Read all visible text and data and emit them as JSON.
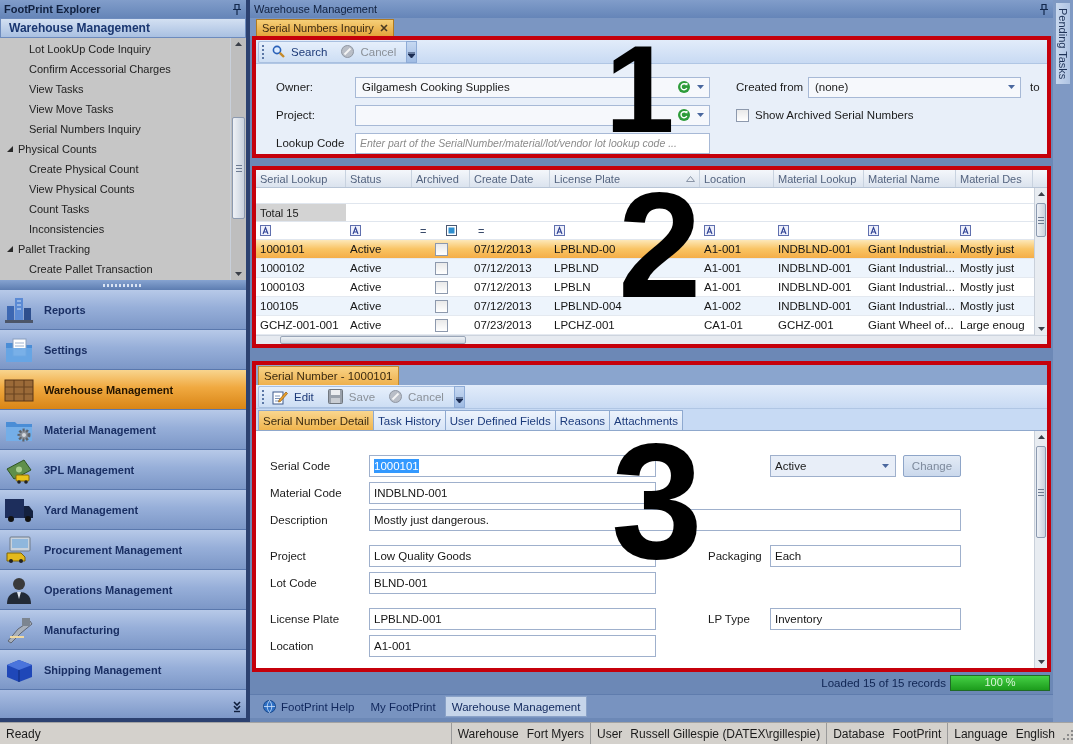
{
  "explorer": {
    "title": "FootPrint Explorer",
    "group": "Warehouse Management",
    "tree": [
      {
        "children": [
          {
            "label": "Lot LookUp Code Inquiry"
          },
          {
            "label": "Confirm Accessorial Charges"
          },
          {
            "label": "View Tasks"
          },
          {
            "label": "View Move Tasks"
          },
          {
            "label": "Serial Numbers Inquiry"
          }
        ]
      },
      {
        "label": "Physical Counts",
        "expanded": true,
        "children": [
          {
            "label": "Create Physical Count"
          },
          {
            "label": "View Physical Counts"
          },
          {
            "label": "Count Tasks"
          },
          {
            "label": "Inconsistencies"
          }
        ]
      },
      {
        "label": "Pallet Tracking",
        "expanded": true,
        "children": [
          {
            "label": "Create Pallet Transaction"
          }
        ]
      }
    ]
  },
  "nav": [
    {
      "label": "Reports",
      "kind": "building",
      "selected": false
    },
    {
      "label": "Settings",
      "kind": "folder",
      "selected": false
    },
    {
      "label": "Warehouse Management",
      "kind": "crate",
      "selected": true
    },
    {
      "label": "Material Management",
      "kind": "gear",
      "selected": false
    },
    {
      "label": "3PL Management",
      "kind": "cash",
      "selected": false
    },
    {
      "label": "Yard Management",
      "kind": "truck",
      "selected": false
    },
    {
      "label": "Procurement Management",
      "kind": "computer",
      "selected": false
    },
    {
      "label": "Operations Management",
      "kind": "person",
      "selected": false
    },
    {
      "label": "Manufacturing",
      "kind": "machine",
      "selected": false
    },
    {
      "label": "Shipping Management",
      "kind": "cube",
      "selected": false
    }
  ],
  "workspace": {
    "title": "Warehouse Management",
    "document_tab": {
      "label": "Serial Numbers Inquiry",
      "selected": true
    }
  },
  "search_panel": {
    "annotation": "1",
    "toolbar": [
      {
        "label": "Search",
        "kind": "search",
        "disabled": false
      },
      {
        "label": "Cancel",
        "kind": "cancel",
        "disabled": true
      }
    ],
    "fields": [
      {
        "kind": "combo",
        "label": "Owner:",
        "value": "Gilgamesh Cooking Supplies"
      },
      {
        "kind": "combo",
        "label": "Project:"
      },
      {
        "kind": "text",
        "label": "Lookup Code",
        "placeholder": "Enter part of the SerialNumber/material/lot/vendor lot lookup code ..."
      }
    ],
    "created_from": {
      "label": "Created from",
      "value": "(none)",
      "after": "to"
    },
    "show_archived": {
      "label": "Show Archived Serial Numbers",
      "checked": false
    }
  },
  "grid": {
    "annotation": "2",
    "columns": [
      {
        "label": "Serial Lookup",
        "sorted": false
      },
      {
        "label": "Status",
        "sorted": false
      },
      {
        "label": "Archived",
        "sorted": false
      },
      {
        "label": "Create Date",
        "sorted": false
      },
      {
        "label": "License Plate",
        "sorted": true
      },
      {
        "label": "Location",
        "sorted": false
      },
      {
        "label": "Material Lookup",
        "sorted": false
      },
      {
        "label": "Material Name",
        "sorted": false
      },
      {
        "label": "Material Des",
        "sorted": false
      }
    ],
    "total": "Total 15",
    "filters": [
      {
        "kind": "text"
      },
      {
        "kind": "text"
      },
      {
        "kind": "check",
        "operator": "="
      },
      {
        "kind": "date",
        "operator": "="
      },
      {
        "kind": "text"
      },
      {
        "kind": "text"
      },
      {
        "kind": "text"
      },
      {
        "kind": "text"
      },
      {
        "kind": "text"
      }
    ],
    "rows": [
      {
        "selected": true,
        "serial": "1000101",
        "status": "Active",
        "archived": false,
        "create_date": "07/12/2013",
        "license_plate": "LPBLND-00",
        "location": "A1-001",
        "material_lookup": "INDBLND-001",
        "material_name": "Giant Industrial...",
        "material_desc": "Mostly just"
      },
      {
        "selected": false,
        "serial": "1000102",
        "status": "Active",
        "archived": false,
        "create_date": "07/12/2013",
        "license_plate": "LPBLND",
        "location": "A1-001",
        "material_lookup": "INDBLND-001",
        "material_name": "Giant Industrial...",
        "material_desc": "Mostly just"
      },
      {
        "selected": false,
        "serial": "1000103",
        "status": "Active",
        "archived": false,
        "create_date": "07/12/2013",
        "license_plate": "LPBLN",
        "location": "A1-001",
        "material_lookup": "INDBLND-001",
        "material_name": "Giant Industrial...",
        "material_desc": "Mostly just"
      },
      {
        "selected": false,
        "serial": "100105",
        "status": "Active",
        "archived": false,
        "create_date": "07/12/2013",
        "license_plate": "LPBLND-004",
        "location": "A1-002",
        "material_lookup": "INDBLND-001",
        "material_name": "Giant Industrial...",
        "material_desc": "Mostly just"
      },
      {
        "selected": false,
        "serial": "GCHZ-001-001",
        "status": "Active",
        "archived": false,
        "create_date": "07/23/2013",
        "license_plate": "LPCHZ-001",
        "location": "CA1-01",
        "material_lookup": "GCHZ-001",
        "material_name": "Giant Wheel of...",
        "material_desc": "Large enoug"
      }
    ]
  },
  "detail_panel": {
    "annotation": "3",
    "tab": {
      "label": "Serial Number - 1000101",
      "selected": true
    },
    "toolbar": [
      {
        "label": "Edit",
        "kind": "edit",
        "disabled": false
      },
      {
        "label": "Save",
        "kind": "save",
        "disabled": true
      },
      {
        "label": "Cancel",
        "kind": "cancel",
        "disabled": true
      }
    ],
    "tabs": [
      {
        "label": "Serial Number Detail",
        "selected": true
      },
      {
        "label": "Task History",
        "selected": false
      },
      {
        "label": "User Defined Fields",
        "selected": false
      },
      {
        "label": "Reasons",
        "selected": false
      },
      {
        "label": "Attachments",
        "selected": false
      }
    ],
    "field_groups": [
      [
        {
          "label": "Serial Code",
          "value": "1000101",
          "highlighted": true,
          "side": {
            "kind": "status",
            "value": "Active",
            "button": {
              "label": "Change",
              "disabled": true
            }
          }
        },
        {
          "label": "Material Code",
          "value": "INDBLND-001",
          "highlighted": false
        },
        {
          "label": "Description",
          "value": "Mostly just dangerous.",
          "highlighted": false,
          "wide": true
        }
      ],
      [
        {
          "label": "Project",
          "value": "Low Quality Goods",
          "highlighted": false,
          "side": {
            "kind": "field",
            "label": "Packaging",
            "value": "Each"
          }
        },
        {
          "label": "Lot Code",
          "value": "BLND-001",
          "highlighted": false
        }
      ],
      [
        {
          "label": "License Plate",
          "value": "LPBLND-001",
          "highlighted": false,
          "side": {
            "kind": "field",
            "label": "LP Type",
            "value": "Inventory"
          }
        },
        {
          "label": "Location",
          "value": "A1-001",
          "highlighted": false
        }
      ]
    ]
  },
  "status_line": {
    "text": "Loaded 15 of 15 records",
    "progress": {
      "level": 1,
      "reading": "100 %"
    }
  },
  "bottom_tabs": [
    {
      "label": "FootPrint Help",
      "kind": "help",
      "selected": false
    },
    {
      "label": "My FootPrint",
      "kind": "plain",
      "selected": false
    },
    {
      "label": "Warehouse Management",
      "kind": "plain",
      "selected": true
    }
  ],
  "side_tab": {
    "label": "Pending Tasks"
  },
  "status_bar": {
    "message": "Ready",
    "segments": [
      {
        "label": "Warehouse",
        "value": "Fort Myers"
      },
      {
        "label": "User",
        "value": "Russell Gillespie (DATEX\\rgillespie)"
      },
      {
        "label": "Database",
        "value": "FootPrint"
      },
      {
        "label": "Language",
        "value": "English"
      }
    ]
  }
}
